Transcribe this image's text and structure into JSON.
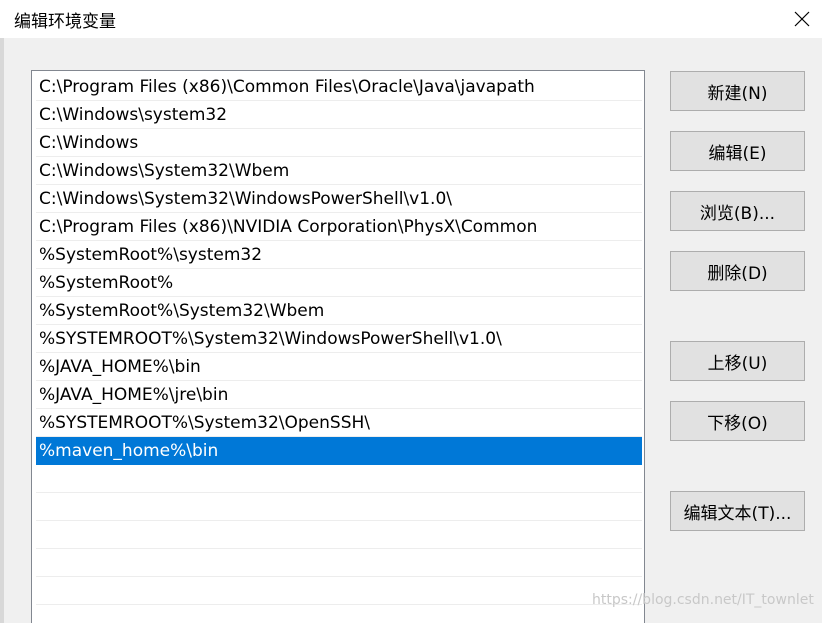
{
  "window": {
    "title": "编辑环境变量"
  },
  "path_list": {
    "items": [
      "C:\\Program Files (x86)\\Common Files\\Oracle\\Java\\javapath",
      "C:\\Windows\\system32",
      "C:\\Windows",
      "C:\\Windows\\System32\\Wbem",
      "C:\\Windows\\System32\\WindowsPowerShell\\v1.0\\",
      "C:\\Program Files (x86)\\NVIDIA Corporation\\PhysX\\Common",
      "%SystemRoot%\\system32",
      "%SystemRoot%",
      "%SystemRoot%\\System32\\Wbem",
      "%SYSTEMROOT%\\System32\\WindowsPowerShell\\v1.0\\",
      "%JAVA_HOME%\\bin",
      "%JAVA_HOME%\\jre\\bin",
      "%SYSTEMROOT%\\System32\\OpenSSH\\",
      "%maven_home%\\bin"
    ],
    "selected_index": 13
  },
  "buttons": {
    "new": "新建(N)",
    "edit": "编辑(E)",
    "browse": "浏览(B)...",
    "delete": "删除(D)",
    "move_up": "上移(U)",
    "move_down": "下移(O)",
    "edit_text": "编辑文本(T)..."
  },
  "watermark": "https://blog.csdn.net/IT_townlet",
  "colors": {
    "selection": "#0078d7",
    "button_face": "#e1e1e1",
    "dialog_bg": "#f0f0f0"
  },
  "icons": {
    "close": "close-icon"
  }
}
